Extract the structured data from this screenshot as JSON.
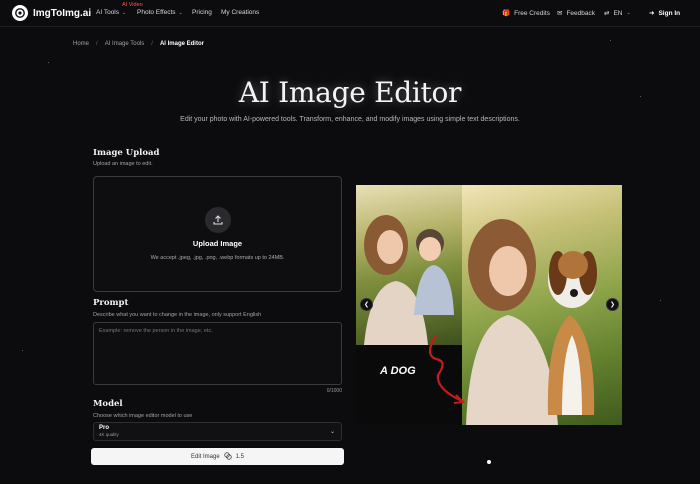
{
  "nav": {
    "logo_text": "ImgToImg.ai",
    "badge": "AI Video",
    "items": [
      {
        "label": "AI Tools"
      },
      {
        "label": "Photo Effects"
      },
      {
        "label": "Pricing"
      },
      {
        "label": "My Creations"
      }
    ],
    "free_credits": "Free Credits",
    "feedback": "Feedback",
    "language": "EN",
    "sign_in": "Sign In"
  },
  "breadcrumb": {
    "home": "Home",
    "tools": "AI Image Tools",
    "current": "AI Image Editor"
  },
  "hero": {
    "title": "AI Image Editor",
    "subtitle": "Edit your photo with AI-powered tools. Transform, enhance, and modify images using simple text descriptions."
  },
  "upload": {
    "title": "Image Upload",
    "desc": "Upload an image to edit.",
    "box_title": "Upload Image",
    "box_sub": "We accept .jpeg, .jpg, .png, .webp formats up to 24MB."
  },
  "prompt": {
    "title": "Prompt",
    "desc": "Describe what you want to change in the image, only support English",
    "placeholder": "Example: remove the person in the image, etc.",
    "counter": "0/1000"
  },
  "model": {
    "title": "Model",
    "desc": "Choose which image editor model to use",
    "selected": "Pro",
    "selected_sub": "4K quality"
  },
  "edit_button": {
    "label": "Edit Image",
    "cost": "1.5"
  },
  "preview": {
    "overlay_text": "A DOG"
  },
  "colors": {
    "background": "#0c0c0e",
    "accent_red": "#ff5a4e",
    "button_bg": "#f5f5f5"
  }
}
